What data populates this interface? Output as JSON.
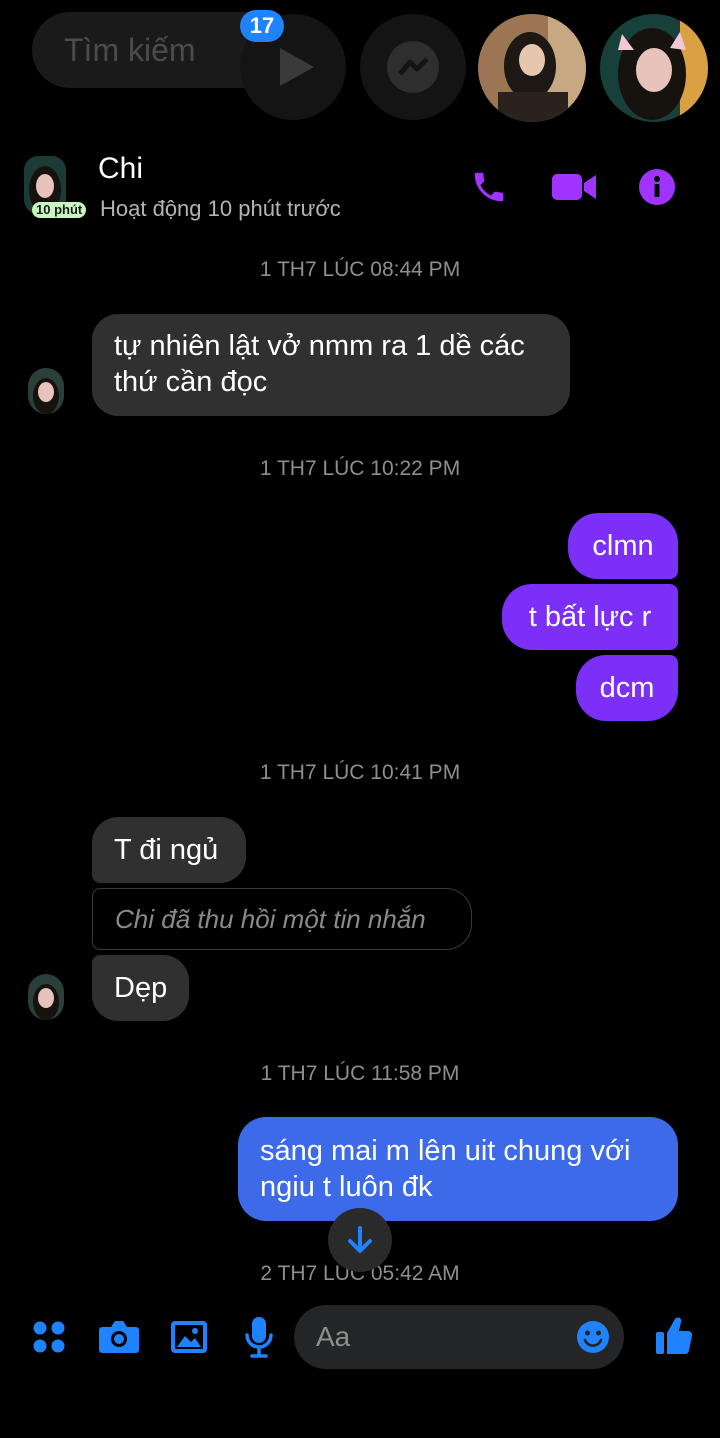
{
  "topbar": {
    "search_placeholder": "Tìm kiếm",
    "video_badge_count": "17"
  },
  "header": {
    "name": "Chi",
    "status": "Hoạt động 10 phút trước",
    "active_badge": "10 phút"
  },
  "messages": {
    "ts1": "1 TH7 LÚC 08:44 PM",
    "in1_line1": "tự nhiên lật vở nmm ra 1 dề các",
    "in1_line2": "thứ cần đọc",
    "ts2": "1 TH7 LÚC 10:22 PM",
    "out1": "clmn",
    "out2": "t bất lực r",
    "out3": "dcm",
    "ts3": "1 TH7 LÚC 10:41 PM",
    "in2": "T đi ngủ",
    "recalled": "Chi đã thu hồi một tin nhắn",
    "in3": "Dẹp",
    "ts4": "1 TH7 LÚC 11:58 PM",
    "out4_line1": "sáng mai m lên uit chung với",
    "out4_line2": "ngiu t luôn đk",
    "ts5": "2 TH7 LÚC 05:42 AM"
  },
  "composer": {
    "placeholder": "Aa"
  },
  "colors": {
    "accent_purple": "#a033ff",
    "sent_bubble": "#7b2ff7",
    "blue_bubble": "#3c6ae9",
    "toolbar_blue": "#1f82ff",
    "received_bubble": "#303030"
  },
  "icons": [
    "play-icon",
    "messenger-icon",
    "phone-icon",
    "video-camera-icon",
    "info-icon",
    "scroll-down-icon",
    "apps-icon",
    "camera-icon",
    "gallery-icon",
    "microphone-icon",
    "emoji-icon",
    "like-icon"
  ]
}
